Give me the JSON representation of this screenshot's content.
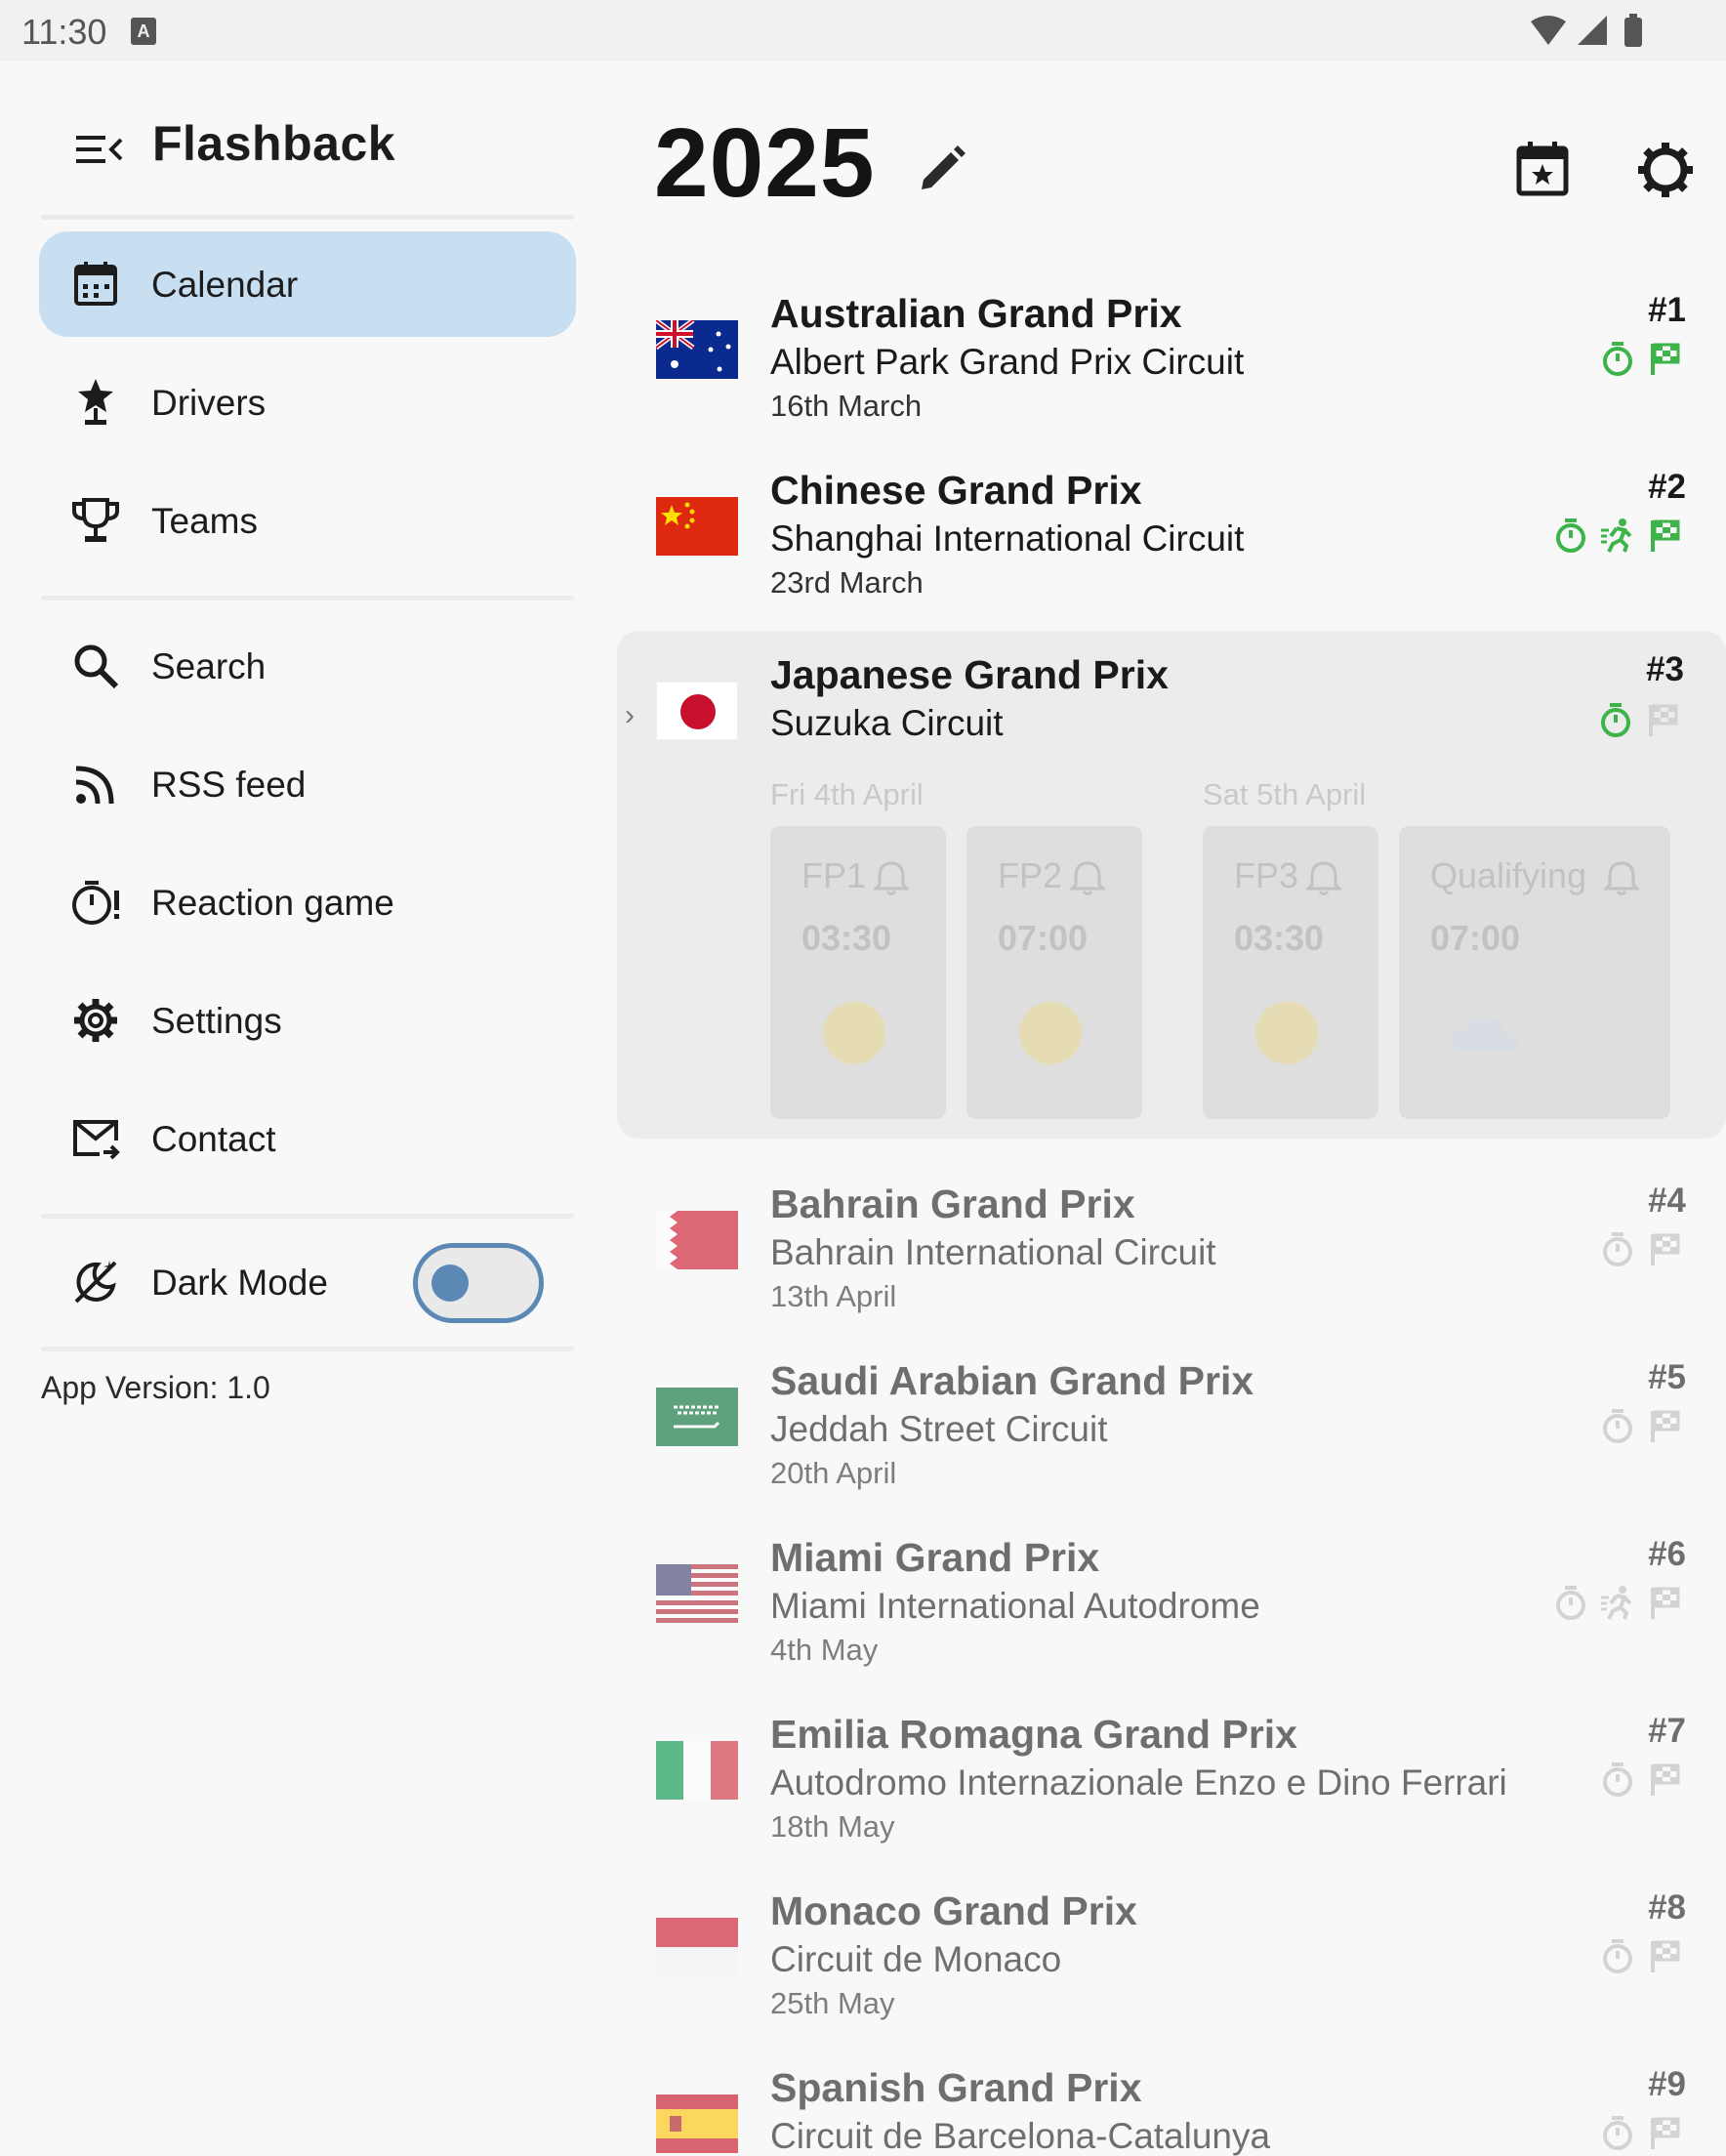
{
  "status_bar": {
    "time": "11:30",
    "notification_icon": "A"
  },
  "drawer": {
    "title": "Flashback",
    "items": [
      {
        "label": "Calendar",
        "icon": "calendar-icon",
        "active": true
      },
      {
        "label": "Drivers",
        "icon": "driver-star-icon"
      },
      {
        "label": "Teams",
        "icon": "trophy-icon"
      },
      {
        "label": "Search",
        "icon": "search-icon"
      },
      {
        "label": "RSS feed",
        "icon": "rss-icon"
      },
      {
        "label": "Reaction game",
        "icon": "timer-alert-icon"
      },
      {
        "label": "Settings",
        "icon": "gear-icon"
      },
      {
        "label": "Contact",
        "icon": "mail-icon"
      }
    ],
    "dark_mode": {
      "label": "Dark Mode",
      "enabled": false
    },
    "version": "App Version: 1.0"
  },
  "header": {
    "year": "2025"
  },
  "races": [
    {
      "round": "#1",
      "name": "Australian Grand Prix",
      "circuit": "Albert Park Grand Prix Circuit",
      "date": "16th March",
      "flag": "australia"
    },
    {
      "round": "#2",
      "name": "Chinese Grand Prix",
      "circuit": "Shanghai International Circuit",
      "date": "23rd March",
      "flag": "china"
    },
    {
      "round": "#3",
      "name": "Japanese Grand Prix",
      "circuit": "Suzuka Circuit",
      "flag": "japan"
    },
    {
      "round": "#4",
      "name": "Bahrain Grand Prix",
      "circuit": "Bahrain International Circuit",
      "date": "13th April",
      "flag": "bahrain"
    },
    {
      "round": "#5",
      "name": "Saudi Arabian Grand Prix",
      "circuit": "Jeddah Street Circuit",
      "date": "20th April",
      "flag": "saudi-arabia"
    },
    {
      "round": "#6",
      "name": "Miami Grand Prix",
      "circuit": "Miami International Autodrome",
      "date": "4th May",
      "flag": "usa"
    },
    {
      "round": "#7",
      "name": "Emilia Romagna Grand Prix",
      "circuit": "Autodromo Internazionale Enzo e Dino Ferrari",
      "date": "18th May",
      "flag": "italy"
    },
    {
      "round": "#8",
      "name": "Monaco Grand Prix",
      "circuit": "Circuit de Monaco",
      "date": "25th May",
      "flag": "monaco"
    },
    {
      "round": "#9",
      "name": "Spanish Grand Prix",
      "circuit": "Circuit de Barcelona-Catalunya",
      "flag": "spain"
    }
  ],
  "japan_sessions": {
    "day1": "Fri 4th April",
    "day2": "Sat 5th April",
    "sessions": [
      {
        "name": "FP1",
        "time": "03:30",
        "weather": "sunny"
      },
      {
        "name": "FP2",
        "time": "07:00",
        "weather": "sunny"
      },
      {
        "name": "FP3",
        "time": "03:30",
        "weather": "sunny"
      },
      {
        "name": "Qualifying",
        "time": "07:00",
        "weather": "cloudy"
      }
    ]
  },
  "colors": {
    "accent": "#c8dff1",
    "status_green": "#3db44a",
    "toggle": "#5b88b5"
  }
}
